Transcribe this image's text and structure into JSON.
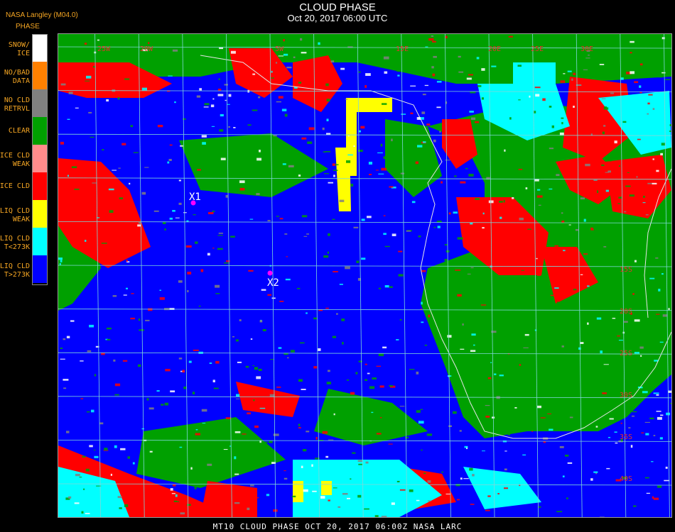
{
  "header": {
    "org_label": "NASA Langley (M04.0)",
    "legend_title": "PHASE",
    "title": "CLOUD PHASE",
    "subtitle": "Oct 20, 2017 06:00 UTC"
  },
  "legend": [
    {
      "label": "SNOW/\nICE",
      "color": "#ffffff"
    },
    {
      "label": "NO/BAD\nDATA",
      "color": "#ff8000"
    },
    {
      "label": "NO CLD\nRETRVL",
      "color": "#808080"
    },
    {
      "label": "CLEAR",
      "color": "#00a000"
    },
    {
      "label": "ICE CLD\nWEAK",
      "color": "#ff8c8c"
    },
    {
      "label": "ICE CLD",
      "color": "#ff0000"
    },
    {
      "label": "LIQ CLD\nWEAK",
      "color": "#ffff00"
    },
    {
      "label": "LIQ CLD\nT<273K",
      "color": "#00ffff"
    },
    {
      "label": "LIQ CLD\nT>273K",
      "color": "#0000ff"
    }
  ],
  "map": {
    "lon_labels": [
      "25W",
      "20W",
      "5W",
      "15E",
      "20E",
      "25E",
      "30E"
    ],
    "lat_labels": [
      "15S",
      "20S",
      "25S",
      "30S",
      "35S",
      "40S"
    ],
    "markers": [
      {
        "label": "X1",
        "color": "#ff00ff"
      },
      {
        "label": "X2",
        "color": "#ff00ff"
      }
    ],
    "colors": {
      "grid": "#7fd8d8",
      "coast": "#e6e6e6",
      "ocean": "#0000ff",
      "label": "#e5322e"
    }
  },
  "footer": {
    "caption": "MT10   CLOUD PHASE   OCT 20, 2017 06:00Z   NASA LARC"
  }
}
